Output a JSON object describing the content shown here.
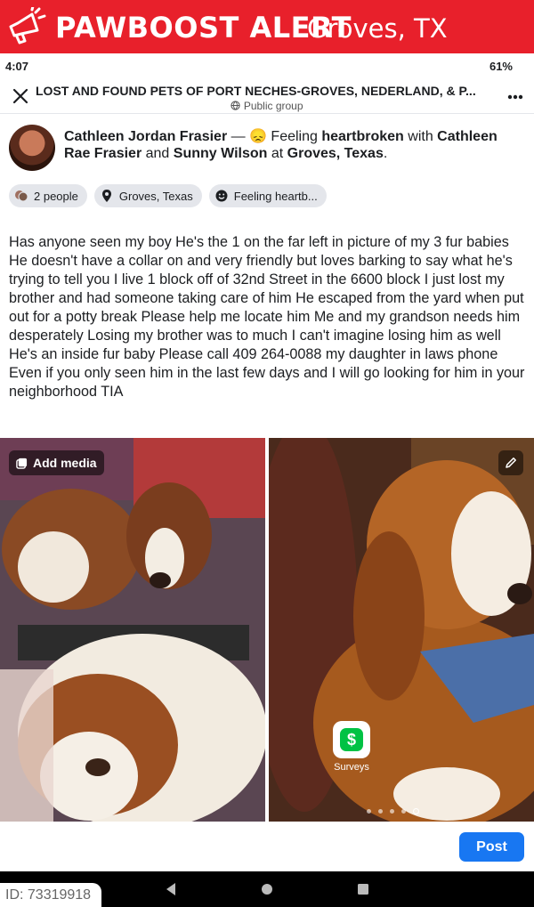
{
  "banner": {
    "brand": "PAWBOOST ALERT",
    "city": "Groves, TX",
    "icon": "megaphone-icon",
    "bg_color": "#e8202b"
  },
  "status": {
    "time": "4:07",
    "battery": "61%"
  },
  "group": {
    "title": "LOST AND FOUND PETS OF PORT NECHES-GROVES, NEDERLAND, & P...",
    "privacy": "Public group",
    "close_icon": "close-icon",
    "more_icon": "more-icon"
  },
  "post": {
    "author": "Cathleen Jordan Frasier",
    "dash": " — ",
    "feeling_prefix": " Feeling ",
    "feeling": "heartbroken",
    "with_text": " with ",
    "tag1": "Cathleen Rae Frasier",
    "and_text": " and ",
    "tag2": "Sunny Wilson",
    "at_text": " at ",
    "location": "Groves, Texas",
    "period": ".",
    "body": "Has anyone seen my boy He's the 1 on the far left in picture of my 3 fur babies He doesn't have a collar on and very friendly but loves barking to say what he's trying to tell you I live 1 block off of 32nd Street in the 6600 block I just lost my brother and had someone taking care of him He escaped from the yard when put out for a potty break Please help me locate him Me and my grandson needs him desperately Losing my brother was to much I can't imagine losing him as well He's an inside fur baby Please call  409 264-0088 my daughter in laws phone Even if you only seen him in the last few days and I will go looking for him in your neighborhood TIA"
  },
  "chips": [
    {
      "label": "2 people",
      "icon": "people-icon"
    },
    {
      "label": "Groves, Texas",
      "icon": "location-pin-icon"
    },
    {
      "label": "Feeling heartb...",
      "icon": "smiley-icon"
    }
  ],
  "media": {
    "add_media_label": "Add media",
    "edit_icon": "pencil-icon",
    "surveys_label": "Surveys",
    "surveys_glyph": "$"
  },
  "actions": {
    "post_label": "Post",
    "accent": "#1877f2"
  },
  "footer": {
    "id": "ID: 73319918"
  }
}
